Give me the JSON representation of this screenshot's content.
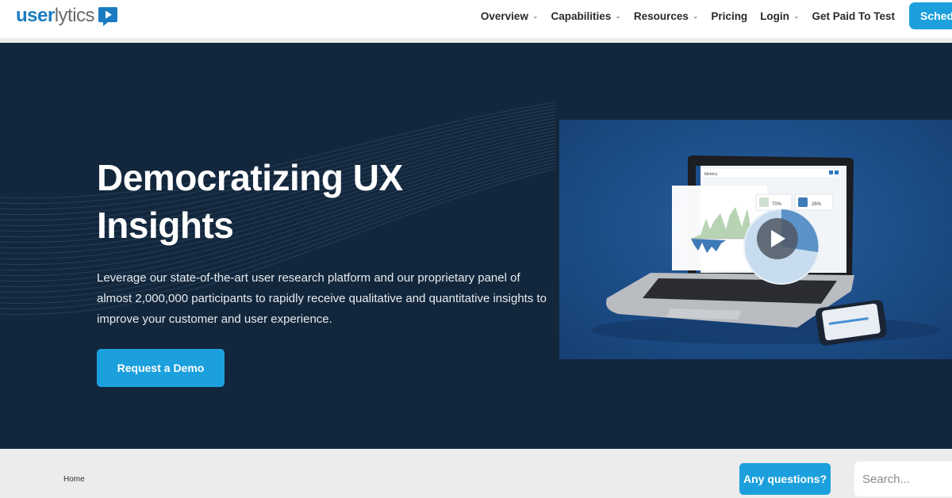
{
  "header": {
    "logo": {
      "part1": "user",
      "part2": "lytics",
      "icon": "play-chat-bubble-icon",
      "brand_color": "#1b7bc0"
    },
    "nav": [
      {
        "label": "Overview",
        "has_dropdown": true
      },
      {
        "label": "Capabilities",
        "has_dropdown": true
      },
      {
        "label": "Resources",
        "has_dropdown": true
      },
      {
        "label": "Pricing",
        "has_dropdown": false
      },
      {
        "label": "Login",
        "has_dropdown": true
      },
      {
        "label": "Get Paid To Test",
        "has_dropdown": false
      }
    ],
    "chevron": "⌄",
    "cta_label": "Schedule a Demo",
    "cta_visible_label": "Sched"
  },
  "hero": {
    "title": "Democratizing UX Insights",
    "description": "Leverage our state-of-the-art user research platform and our proprietary panel of almost 2,000,000 participants to rapidly receive qualitative and quantitative insights to improve your customer and user experience.",
    "button_label": "Request a Demo",
    "background_color": "#13273c",
    "accent_color": "#1ca0dd",
    "video": {
      "play_icon": "play-icon",
      "screen_title": "Metrics",
      "stat_1": "70%",
      "stat_2": "26%"
    }
  },
  "breadcrumb_bar": {
    "crumbs": [
      "Home"
    ],
    "questions_label": "Any questions?",
    "search_placeholder": "Search..."
  }
}
